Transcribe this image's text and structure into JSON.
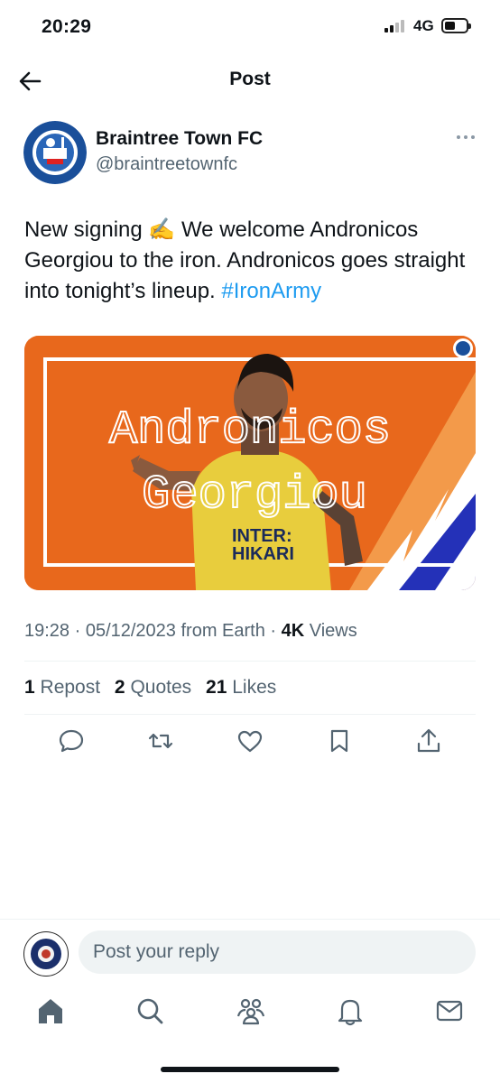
{
  "status_bar": {
    "time": "20:29",
    "network": "4G",
    "icons": [
      "signal-icon",
      "battery-icon"
    ]
  },
  "header": {
    "title": "Post",
    "back_icon": "back-arrow-icon"
  },
  "tweet": {
    "author_name": "Braintree Town FC",
    "author_handle": "@braintreetownfc",
    "text_before_hashtag": "New signing ✍️ We welcome Andronicos Georgiou to the iron. Andronicos goes straight into tonight’s lineup. ",
    "hashtag": "#IronArmy",
    "media": {
      "line1": "Andronicos",
      "line2": "Georgiou",
      "shirt_text_1": "INTER:",
      "shirt_text_2": "HIKARI",
      "background_color": "#e8681c"
    },
    "timestamp": "19:28 · 05/12/2023 from Earth · ",
    "views_count": "4K",
    "views_label": " Views",
    "reposts_count": "1",
    "reposts_label": "Repost",
    "quotes_count": "2",
    "quotes_label": "Quotes",
    "likes_count": "21",
    "likes_label": "Likes"
  },
  "actions": [
    "reply-icon",
    "repost-icon",
    "like-icon",
    "bookmark-icon",
    "share-icon"
  ],
  "reply": {
    "placeholder": "Post your reply"
  },
  "tab_bar": [
    "home-icon",
    "search-icon",
    "communities-icon",
    "notifications-icon",
    "messages-icon"
  ],
  "colors": {
    "accent": "#1d9bf0",
    "secondary_text": "#536471",
    "primary_text": "#0f1419"
  }
}
